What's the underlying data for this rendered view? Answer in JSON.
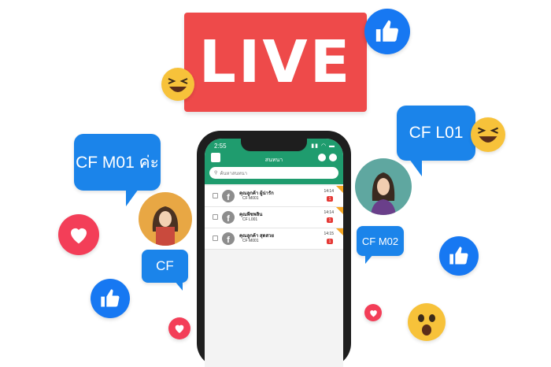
{
  "live_sign": {
    "label": "LIVE"
  },
  "bubbles": {
    "left_main": "CF M01 ค่ะ",
    "right_main": "CF L01",
    "right_small": "CF M02",
    "left_small": "CF"
  },
  "phone": {
    "time": "2:55",
    "title": "สนทนา",
    "search_placeholder": "ค้นหาสนทนา",
    "rows": [
      {
        "name": "คุณลูกค้า ผู้น่ารัก",
        "code": "CF M001",
        "time": "14:14",
        "badge": "1"
      },
      {
        "name": "คุณพีชพลิน",
        "code": "CF L001",
        "time": "14:14",
        "badge": "1"
      },
      {
        "name": "คุณลูกค้า สุดสวย",
        "code": "CF M001",
        "time": "14:15",
        "badge": "1"
      }
    ]
  },
  "colors": {
    "live_red": "#ee4a4a",
    "bubble_blue": "#1b84ea",
    "like_blue": "#1778f2",
    "heart_red": "#f33e58",
    "app_green": "#1f9c6e"
  },
  "icons": [
    "like-icon",
    "heart-icon",
    "laughing-emoji-icon",
    "surprised-emoji-icon",
    "facebook-icon",
    "search-icon"
  ]
}
